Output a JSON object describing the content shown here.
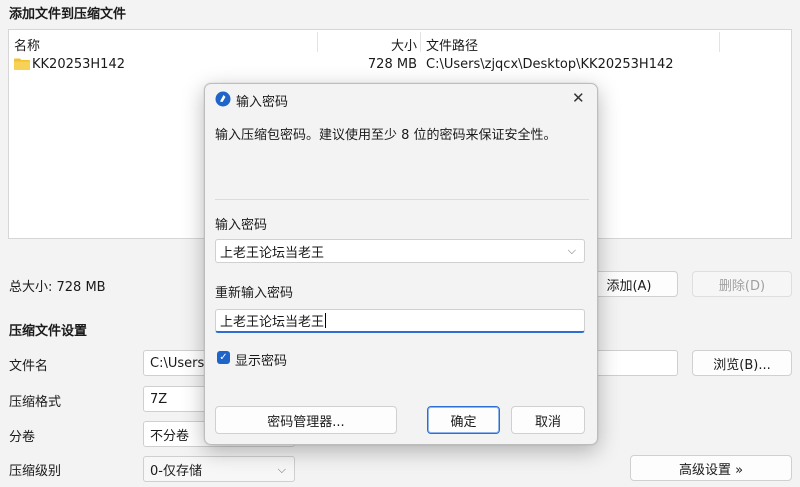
{
  "section_add": {
    "title": "添加文件到压缩文件"
  },
  "filelist": {
    "columns": {
      "name": "名称",
      "size": "大小",
      "path": "文件路径"
    },
    "rows": [
      {
        "name": "KK20253H142",
        "size": "728 MB",
        "path": "C:\\Users\\zjqcx\\Desktop\\KK20253H142"
      }
    ]
  },
  "summary": {
    "total": "总大小: 728 MB"
  },
  "actions": {
    "add": "添加(A)",
    "delete": "删除(D)"
  },
  "settings": {
    "title": "压缩文件设置",
    "filename_label": "文件名",
    "filename_value": "C:\\Users\\",
    "browse": "浏览(B)...",
    "format_label": "压缩格式",
    "format_value": "7Z",
    "split_label": "分卷",
    "split_value": "不分卷",
    "level_label": "压缩级别",
    "level_value": "0-仅存储",
    "advanced": "高级设置 »"
  },
  "dialog": {
    "title": "输入密码",
    "description": "输入压缩包密码。建议使用至少 8 位的密码来保证安全性。",
    "password_label": "输入密码",
    "password_value": "上老王论坛当老王",
    "reenter_label": "重新输入密码",
    "reenter_value": "上老王论坛当老王",
    "show_password": "显示密码",
    "manager_button": "密码管理器...",
    "ok_button": "确定",
    "cancel_button": "取消",
    "close_glyph": "✕",
    "checkmark": "✓",
    "dropdown_glyph": "⌵"
  },
  "icons": {
    "folder_color": "#f2c230",
    "app_icon_color": "#1f64c8",
    "accent": "#2a6fd1"
  }
}
